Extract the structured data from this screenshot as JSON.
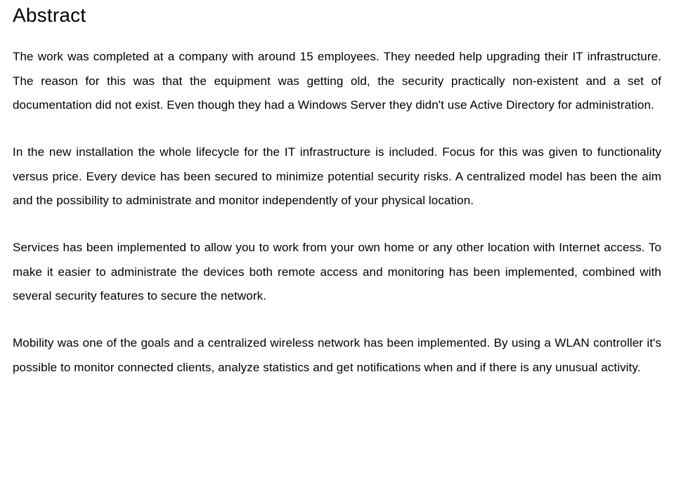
{
  "title": "Abstract",
  "paragraphs": {
    "p1": "The work was completed at a company with around 15 employees. They needed help upgrading their IT infrastructure. The reason for this was that the equipment was getting old, the security practically non-existent and a set of documentation did not exist. Even though they had a Windows Server they didn't use Active Directory for administration.",
    "p2": "In the new installation the whole lifecycle for the IT infrastructure is included. Focus for this was given to functionality versus price. Every device has been secured to minimize potential security risks. A centralized model has been the aim and the possibility to administrate and monitor independently of your physical location.",
    "p3": "Services has been implemented to allow you to work from your own home or any other location with Internet access. To make it easier to administrate the devices both remote access and monitoring has been implemented, combined with several security features to secure the network.",
    "p4": "Mobility was one of the goals and a centralized wireless network has been implemented. By using a WLAN controller it's possible to monitor connected clients, analyze statistics and get notifications when and if there is any unusual activity."
  }
}
